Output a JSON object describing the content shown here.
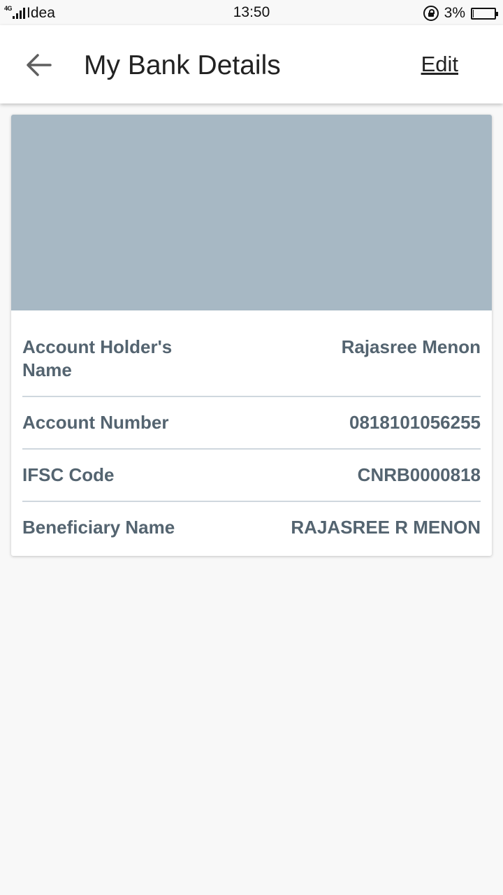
{
  "status_bar": {
    "network_type": "4G",
    "carrier": "Idea",
    "time": "13:50",
    "battery_percent": "3%",
    "battery_level": 0.03
  },
  "app_bar": {
    "title": "My Bank Details",
    "back_icon": "arrow-back-icon",
    "edit_label": "Edit"
  },
  "bank_details": {
    "banner_color": "#a7b8c4",
    "rows": [
      {
        "label": "Account Holder's Name",
        "value": "Rajasree Menon"
      },
      {
        "label": "Account Number",
        "value": "0818101056255"
      },
      {
        "label": "IFSC Code",
        "value": "CNRB0000818"
      },
      {
        "label": "Beneficiary Name",
        "value": "RAJASREE R MENON"
      }
    ]
  }
}
